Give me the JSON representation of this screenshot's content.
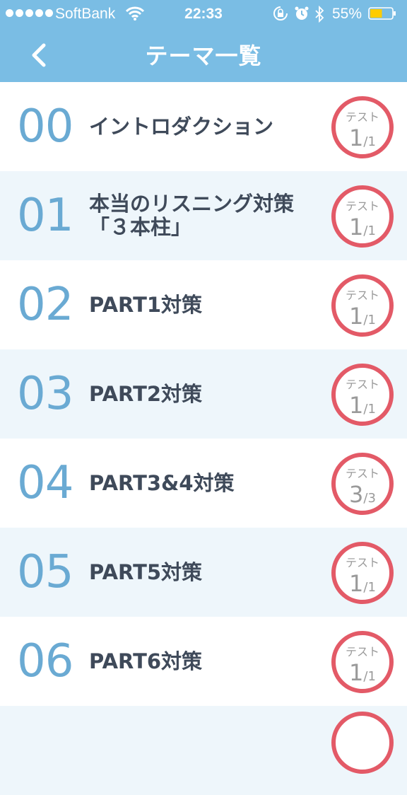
{
  "status_bar": {
    "carrier": "SoftBank",
    "time": "22:33",
    "battery_percent": "55%",
    "battery_level": 0.55,
    "battery_color": "#ffcc00"
  },
  "nav": {
    "title": "テーマ一覧",
    "back_icon": "chevron-left-icon"
  },
  "colors": {
    "header_bg": "#7abde4",
    "row_alt_bg": "#eef6fb",
    "number_color": "#6aaad3",
    "badge_ring": "#e35a67",
    "title_color": "#3f4a5a"
  },
  "themes": [
    {
      "number": "00",
      "title": "イントロダクション",
      "badge_label": "テスト",
      "done": "1",
      "total": "/1"
    },
    {
      "number": "01",
      "title": "本当のリスニング対策\n「３本柱」",
      "badge_label": "テスト",
      "done": "1",
      "total": "/1"
    },
    {
      "number": "02",
      "title": "PART1対策",
      "badge_label": "テスト",
      "done": "1",
      "total": "/1"
    },
    {
      "number": "03",
      "title": "PART2対策",
      "badge_label": "テスト",
      "done": "1",
      "total": "/1"
    },
    {
      "number": "04",
      "title": "PART3&4対策",
      "badge_label": "テスト",
      "done": "3",
      "total": "/3"
    },
    {
      "number": "05",
      "title": "PART5対策",
      "badge_label": "テスト",
      "done": "1",
      "total": "/1"
    },
    {
      "number": "06",
      "title": "PART6対策",
      "badge_label": "テスト",
      "done": "1",
      "total": "/1"
    }
  ]
}
